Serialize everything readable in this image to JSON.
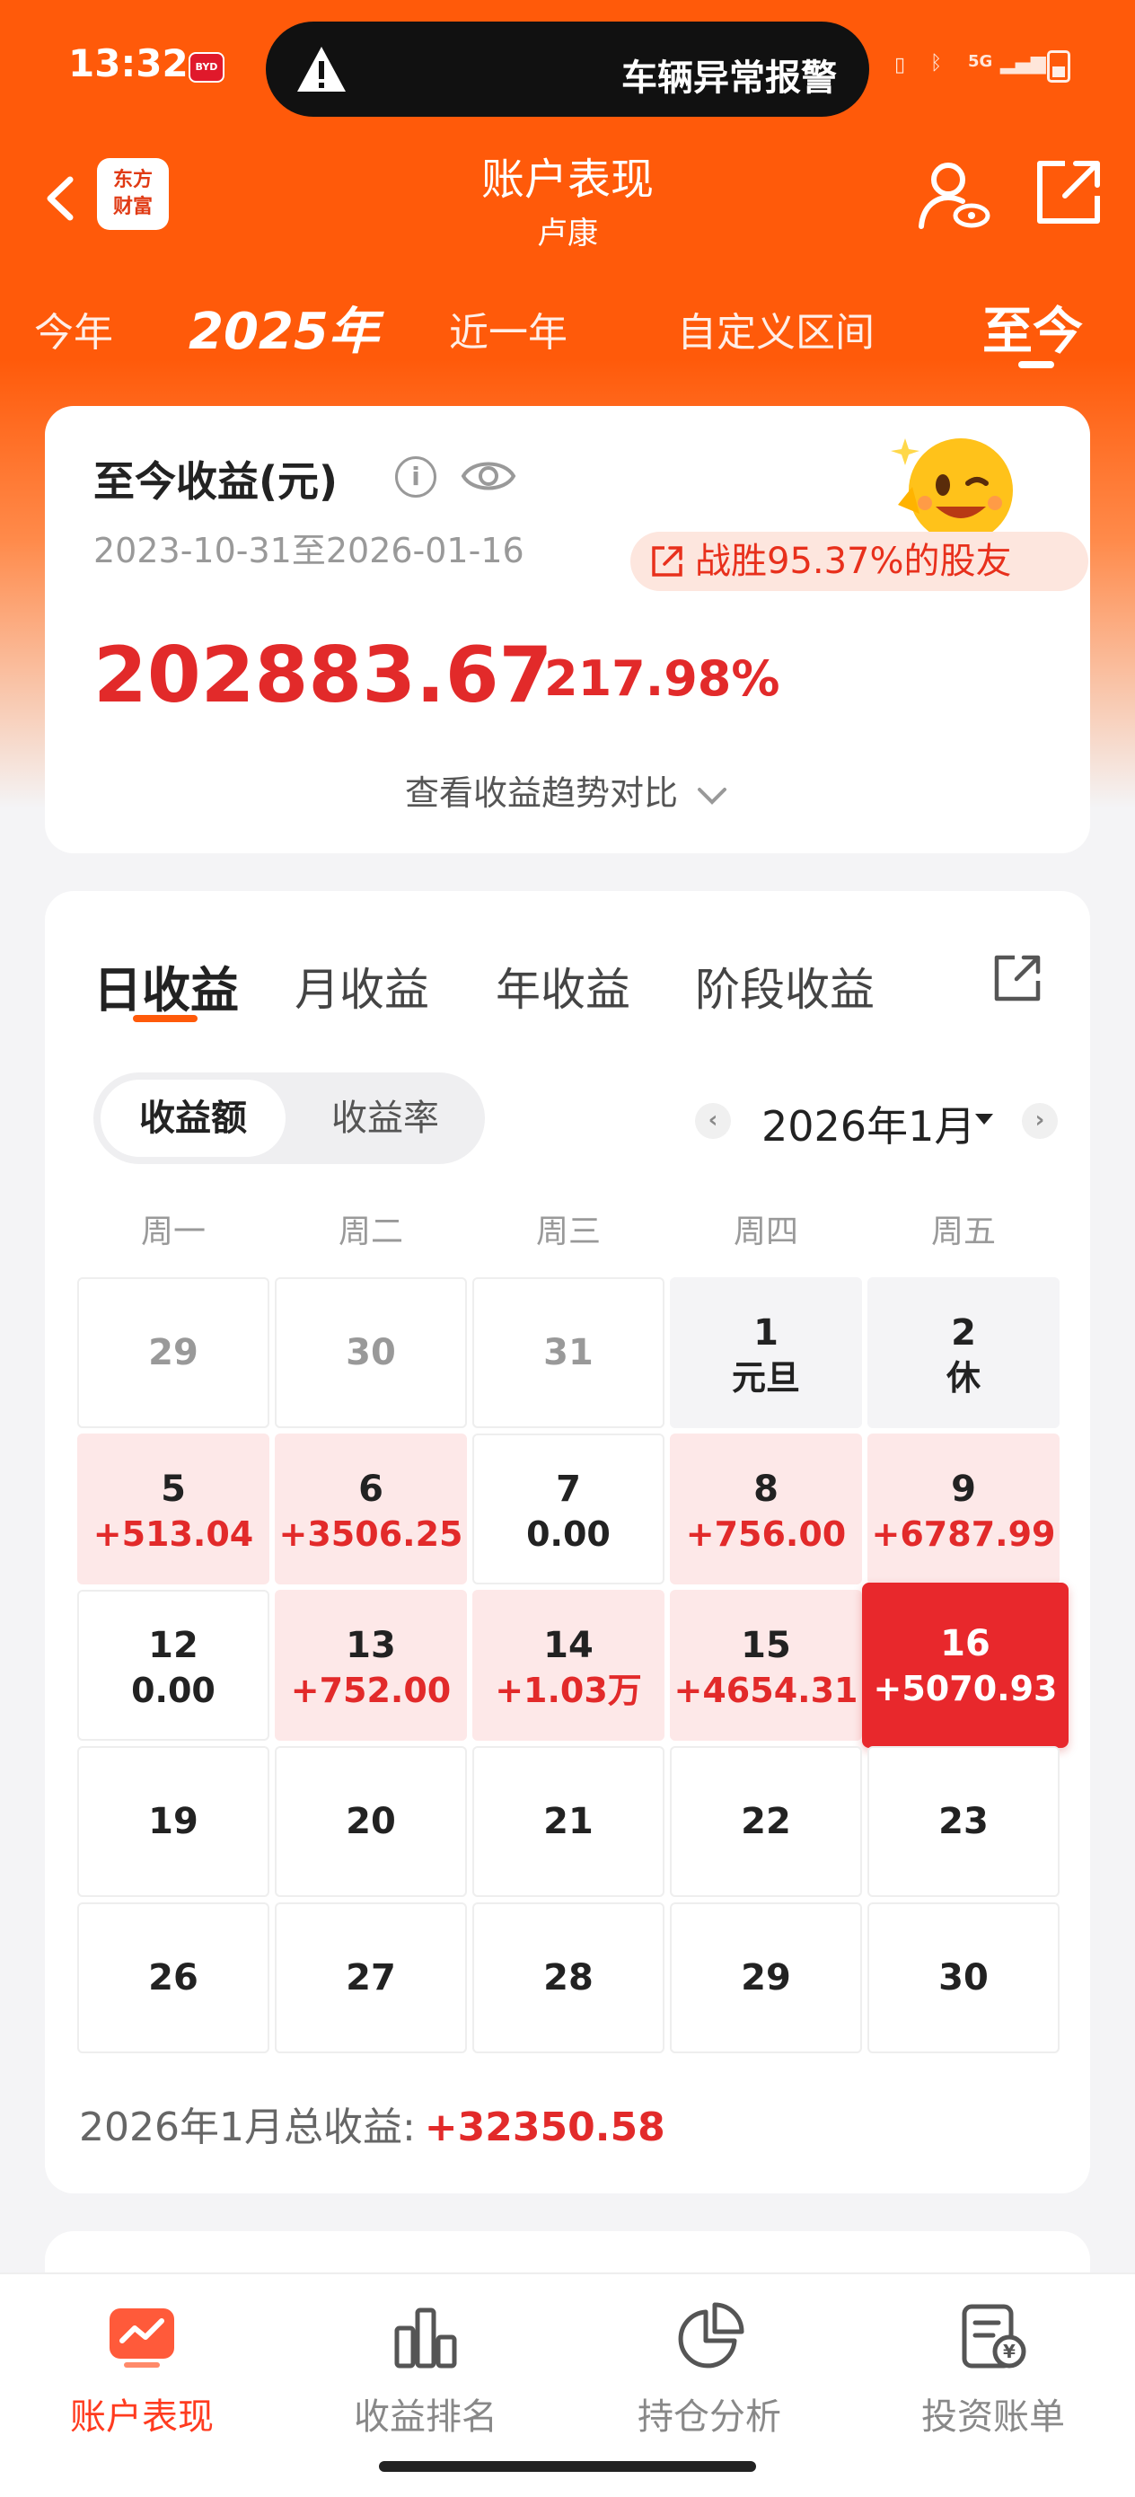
{
  "status_bar": {
    "time": "13:32",
    "alert": "车辆异常报警",
    "network": "5G"
  },
  "header": {
    "logo_line1": "东方",
    "logo_line2": "财富",
    "title": "账户表现",
    "subtitle": "卢康"
  },
  "ranges": [
    "今年",
    "2025年",
    "近一年",
    "自定义区间",
    "至今"
  ],
  "summary": {
    "label": "至今收益(元)",
    "info": "i",
    "date_range": "2023-10-31至2026-01-16",
    "beat_text": "战胜95.37%的股友",
    "amount": "202883.67",
    "percent": "217.98%",
    "trend_link": "查看收益趋势对比"
  },
  "period_tabs": [
    "日收益",
    "月收益",
    "年收益",
    "阶段收益"
  ],
  "toggle": [
    "收益额",
    "收益率"
  ],
  "month": "2026年1月",
  "prev": "‹",
  "next": "›",
  "weekdays": [
    "周一",
    "周二",
    "周三",
    "周四",
    "周五"
  ],
  "calendar": [
    [
      {
        "d": "29",
        "t": "other"
      },
      {
        "d": "30",
        "t": "other"
      },
      {
        "d": "31",
        "t": "other"
      },
      {
        "d": "1",
        "v": "元旦",
        "t": "hol"
      },
      {
        "d": "2",
        "v": "休",
        "t": "hol"
      }
    ],
    [
      {
        "d": "5",
        "v": "+513.04",
        "t": "gain"
      },
      {
        "d": "6",
        "v": "+3506.25",
        "t": "gain"
      },
      {
        "d": "7",
        "v": "0.00",
        "t": "flat"
      },
      {
        "d": "8",
        "v": "+756.00",
        "t": "gain"
      },
      {
        "d": "9",
        "v": "+6787.99",
        "t": "gain"
      }
    ],
    [
      {
        "d": "12",
        "v": "0.00",
        "t": "flat"
      },
      {
        "d": "13",
        "v": "+752.00",
        "t": "gain"
      },
      {
        "d": "14",
        "v": "+1.03万",
        "t": "gain"
      },
      {
        "d": "15",
        "v": "+4654.31",
        "t": "gain"
      },
      {
        "d": "16",
        "v": "+5070.93",
        "t": "today"
      }
    ],
    [
      {
        "d": "19",
        "t": "empty"
      },
      {
        "d": "20",
        "t": "empty"
      },
      {
        "d": "21",
        "t": "empty"
      },
      {
        "d": "22",
        "t": "empty"
      },
      {
        "d": "23",
        "t": "empty"
      }
    ],
    [
      {
        "d": "26",
        "t": "empty"
      },
      {
        "d": "27",
        "t": "empty"
      },
      {
        "d": "28",
        "t": "empty"
      },
      {
        "d": "29",
        "t": "empty"
      },
      {
        "d": "30",
        "t": "empty"
      }
    ]
  ],
  "total": {
    "label": "2026年1月总收益:",
    "value": "+32350.58"
  },
  "tabbar": [
    "账户表现",
    "收益排名",
    "持仓分析",
    "投资账单"
  ],
  "colors": {
    "brand": "#ff5a0a",
    "gain": "#e22a2a",
    "gain_bg": "#fde8e8"
  }
}
